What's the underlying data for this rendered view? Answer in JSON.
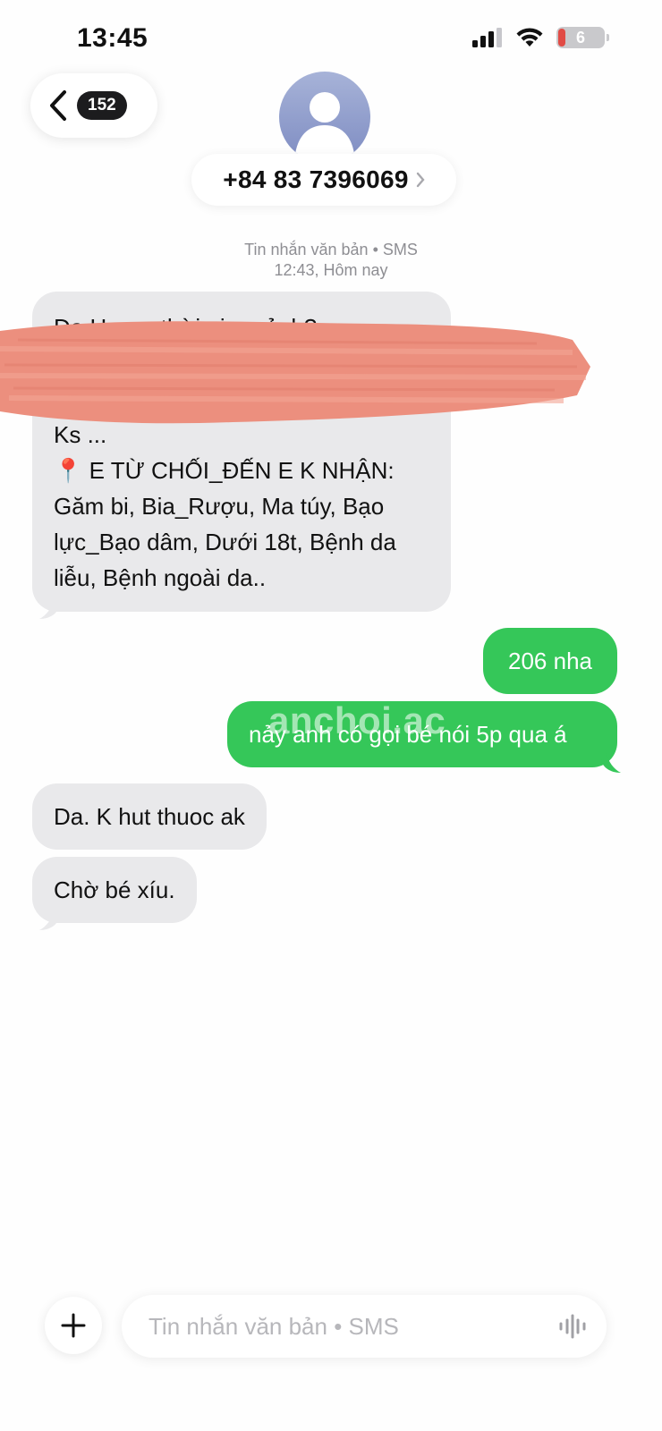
{
  "status_bar": {
    "time": "13:45",
    "battery_level": "6",
    "icons": [
      "cellular-signal-icon",
      "wifi-icon",
      "battery-icon"
    ]
  },
  "header": {
    "back_count": "152",
    "contact": "+84 83 7396069",
    "icons": [
      "back-chevron-icon",
      "contact-avatar-icon",
      "chevron-right-icon"
    ]
  },
  "conversation": {
    "meta_line1": "Tin nhắn văn bản • SMS",
    "meta_line2": "12:43, Hôm nay",
    "messages": [
      {
        "direction": "incoming",
        "lines": [
          "Dạ Hợp e thời gian rảnh?",
          "",
          "",
          "Ks ...",
          "📍 E TỪ CHỐI_ĐẾN E K NHẬN:",
          "Găm bi, Bia_Rượu, Ma túy, Bạo",
          "lực_Bạo dâm, Dưới 18t, Bệnh da",
          "liễu, Bệnh ngoài da.."
        ]
      },
      {
        "direction": "outgoing",
        "text": "206 nha"
      },
      {
        "direction": "outgoing",
        "text": "nảy anh có gọi bé nói 5p qua á"
      },
      {
        "direction": "incoming",
        "text": "Da. K hut thuoc ak"
      },
      {
        "direction": "incoming",
        "text": "Chờ bé xíu."
      }
    ],
    "watermark": "anchoi.ac",
    "redaction_color": "#ec8f7e"
  },
  "composer": {
    "placeholder": "Tin nhắn văn bản • SMS",
    "icons": [
      "plus-icon",
      "audio-waveform-icon"
    ]
  },
  "colors": {
    "incoming_bubble": "#e9e9eb",
    "outgoing_bubble": "#35c759",
    "background": "#fefefe"
  }
}
